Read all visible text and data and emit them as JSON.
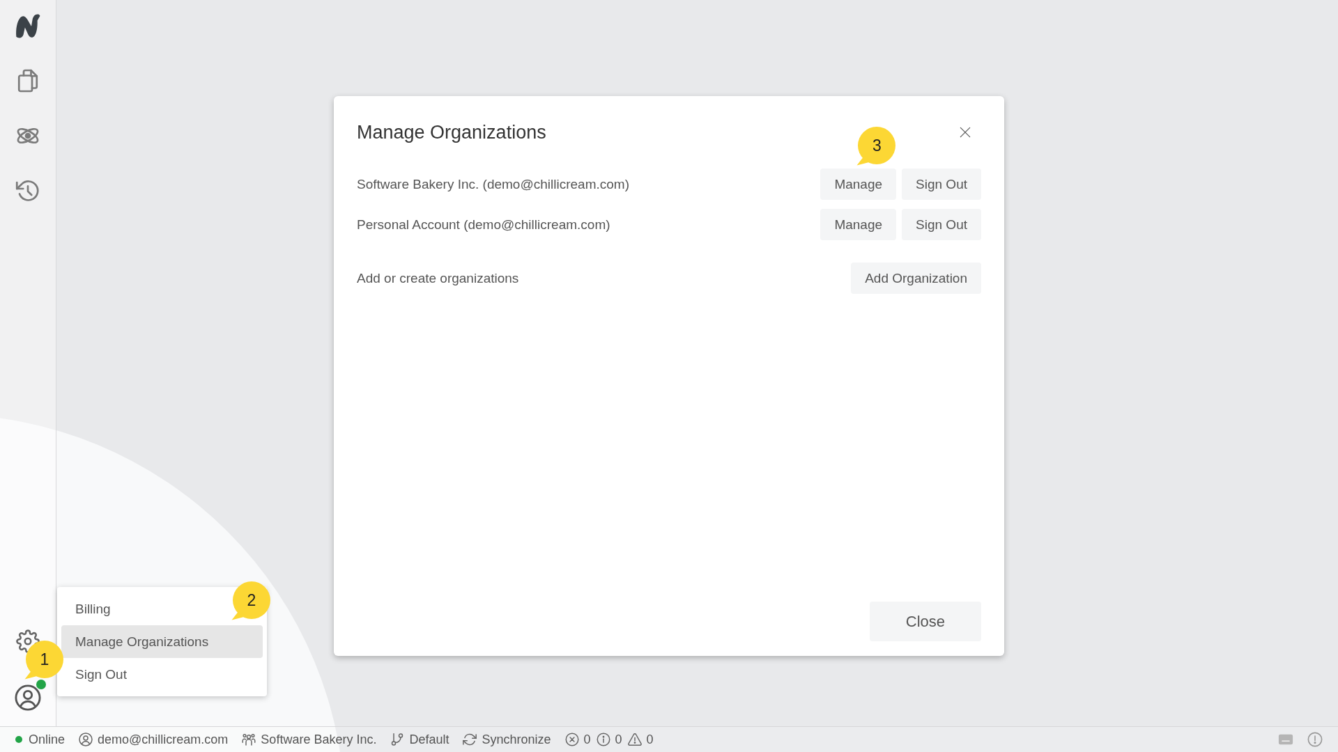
{
  "sidebar": {
    "user_online": true,
    "marker": "1"
  },
  "user_menu": {
    "items": [
      {
        "label": "Billing",
        "selected": false
      },
      {
        "label": "Manage Organizations",
        "selected": true
      },
      {
        "label": "Sign Out",
        "selected": false
      }
    ],
    "marker": "2"
  },
  "dialog": {
    "title": "Manage Organizations",
    "organizations": [
      {
        "name": "Software Bakery Inc. (demo@chillicream.com)",
        "actions": [
          "Manage",
          "Sign Out"
        ],
        "marker": "3"
      },
      {
        "name": "Personal Account (demo@chillicream.com)",
        "actions": [
          "Manage",
          "Sign Out"
        ]
      }
    ],
    "add_row": {
      "label": "Add or create organizations",
      "button": "Add Organization"
    },
    "close_button": "Close"
  },
  "status_bar": {
    "connection": {
      "label": "Online",
      "online": true
    },
    "items": [
      {
        "kind": "user",
        "label": "demo@chillicream.com"
      },
      {
        "kind": "organization",
        "label": "Software Bakery Inc."
      },
      {
        "kind": "branch",
        "label": "Default"
      },
      {
        "kind": "sync",
        "label": "Synchronize"
      },
      {
        "kind": "errors",
        "label": "0"
      },
      {
        "kind": "info",
        "label": "0"
      },
      {
        "kind": "warnings",
        "label": "0"
      }
    ]
  }
}
